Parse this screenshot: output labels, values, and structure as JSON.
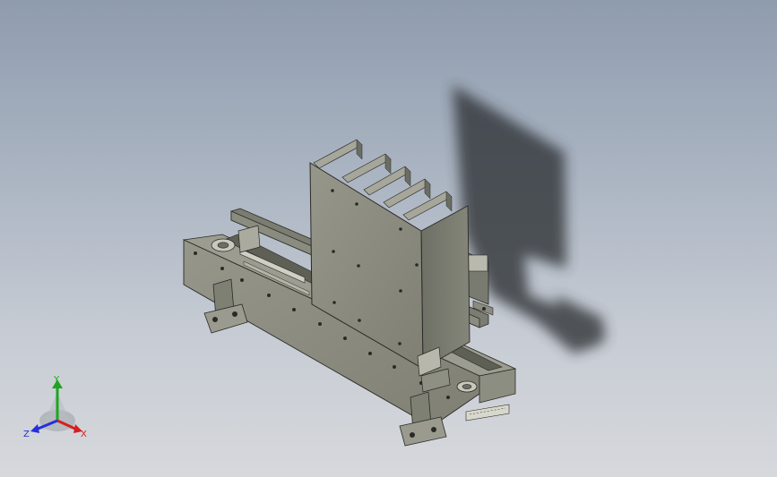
{
  "viewport": {
    "background_top": "#8f9cae",
    "background_bottom": "#d6d8dc",
    "model_color": "#8a8a7c",
    "shadow_color": "#2e3136"
  },
  "triad": {
    "x_label": "X",
    "y_label": "Y",
    "z_label": "Z",
    "x_color": "#d42020",
    "y_color": "#1fa51f",
    "z_color": "#2430d8"
  }
}
